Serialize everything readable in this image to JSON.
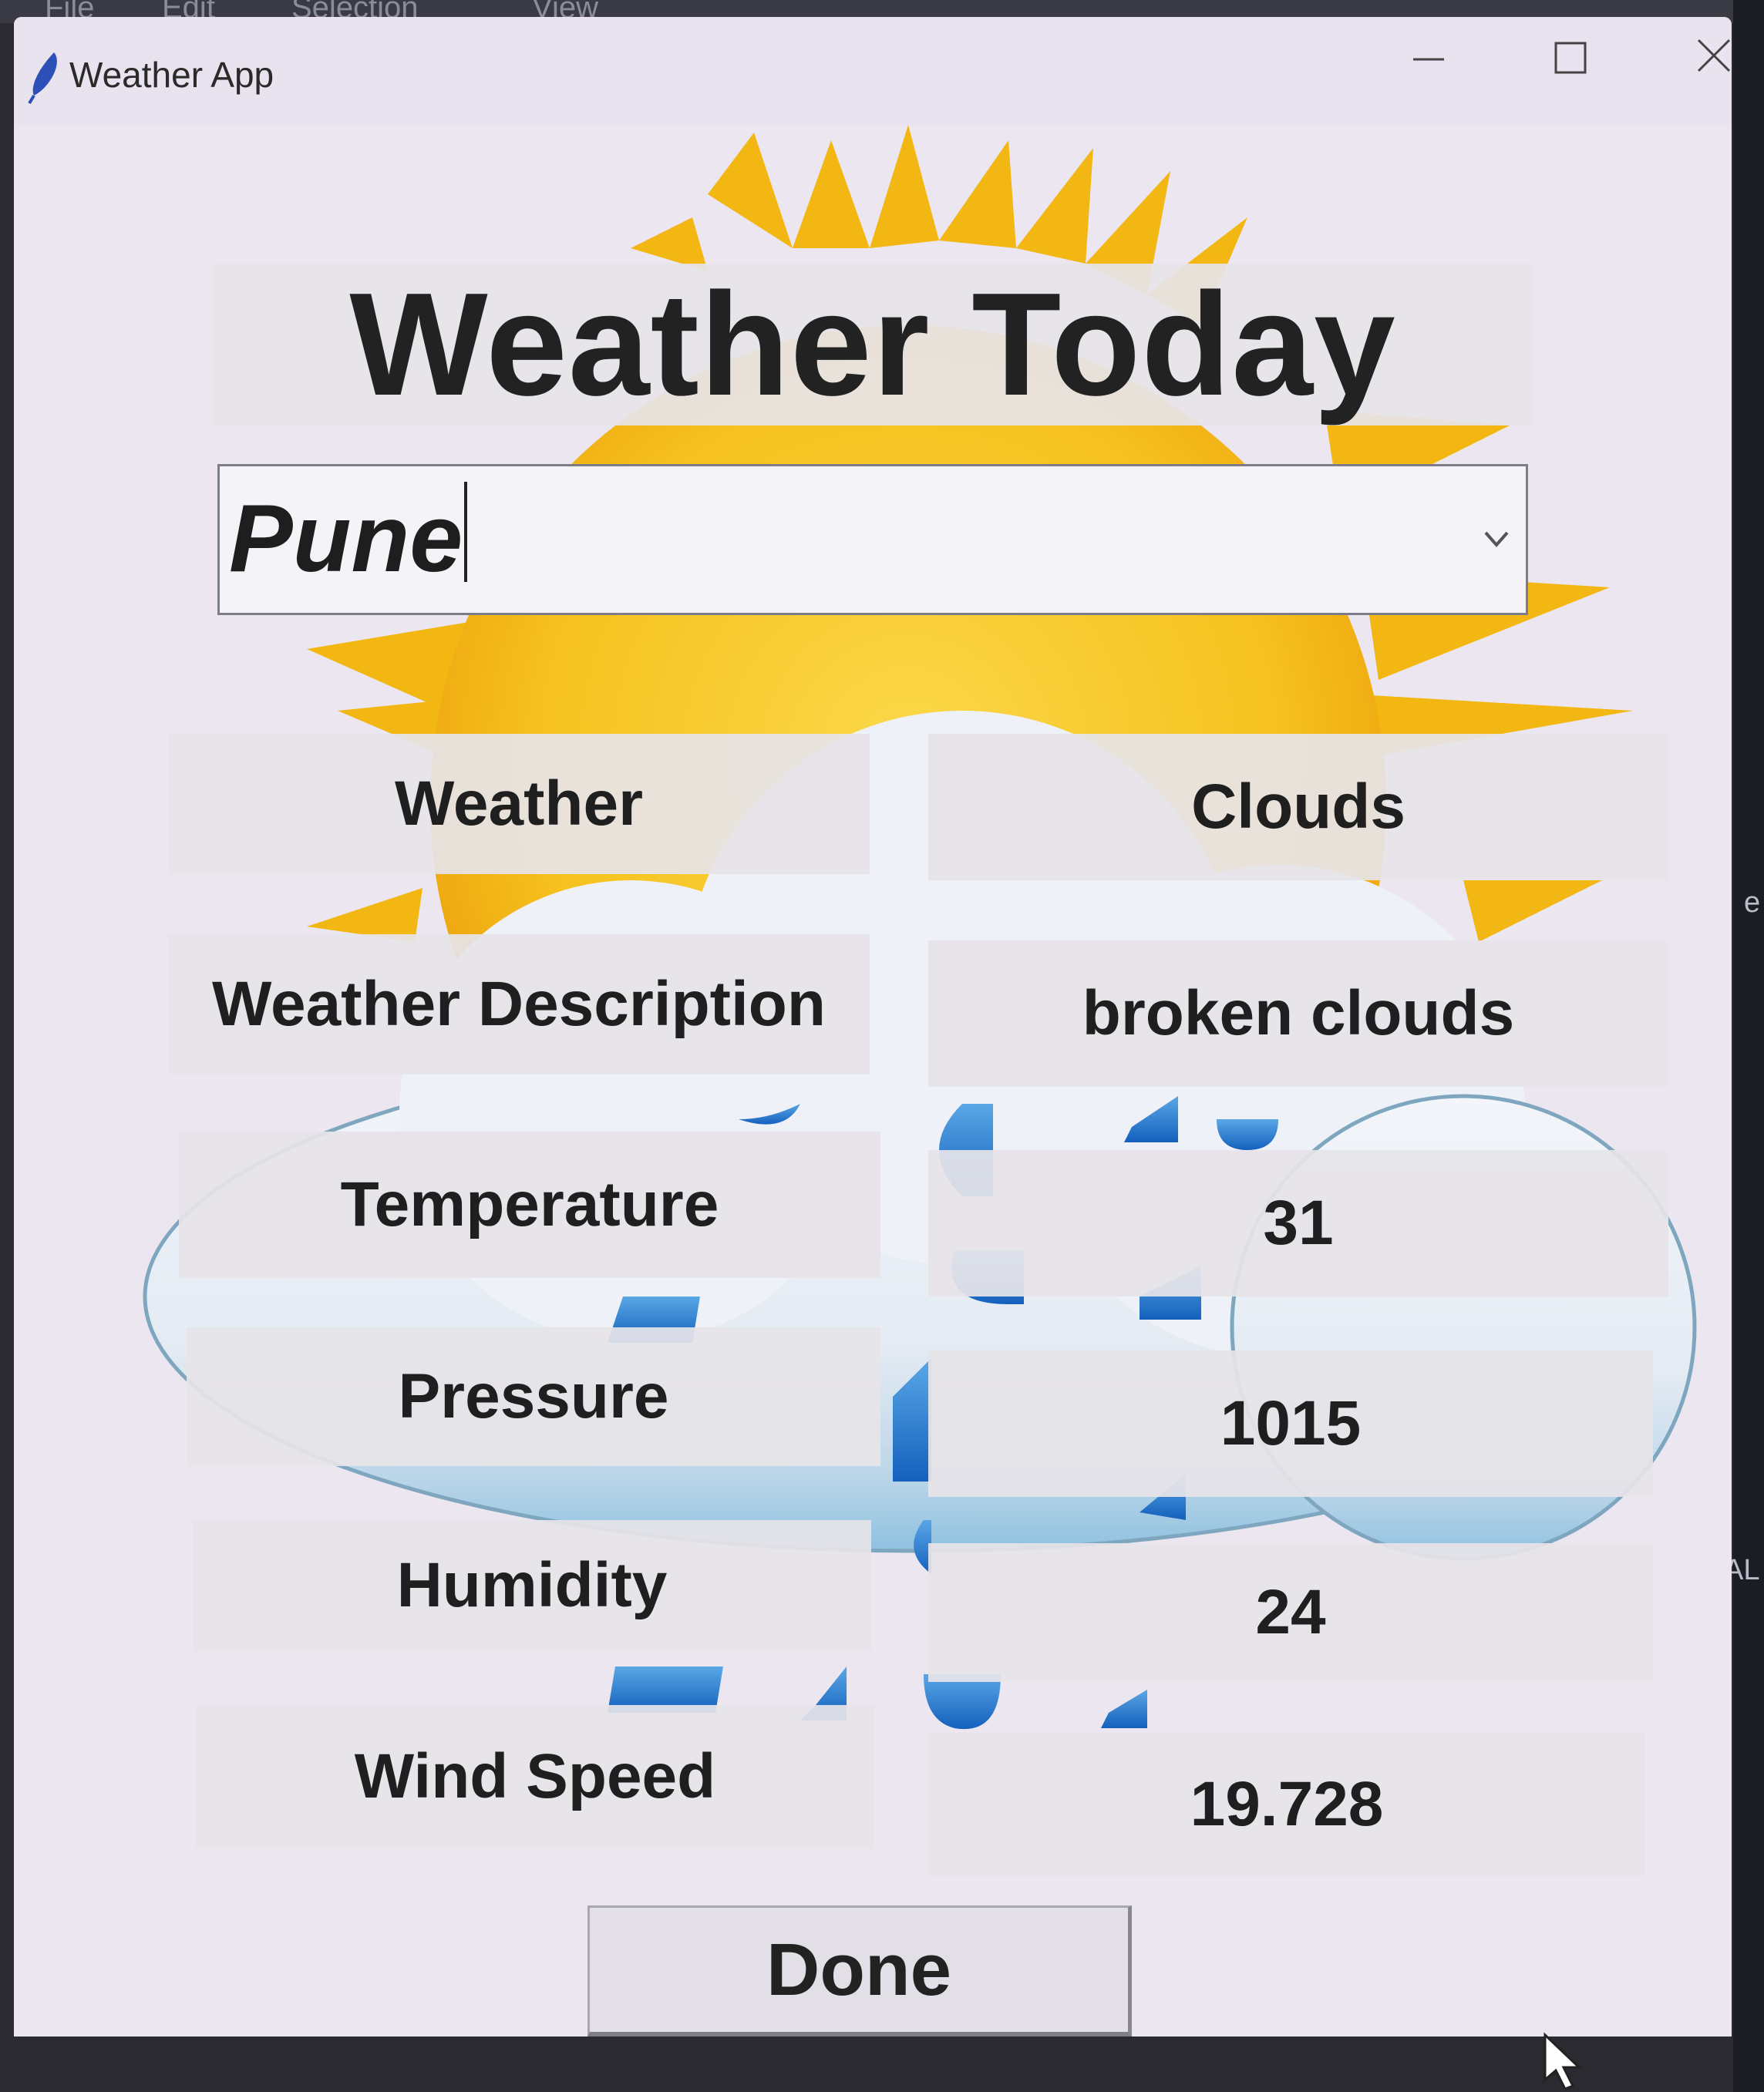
{
  "background": {
    "menu_items": [
      "File",
      "Edit",
      "Selection",
      "View"
    ],
    "side_text": [
      "e",
      "AL"
    ]
  },
  "window": {
    "title": "Weather App",
    "controls": [
      "minimize-icon",
      "maximize-icon",
      "close-icon"
    ]
  },
  "app": {
    "heading": "Weather Today",
    "city_input": {
      "value": "Pune"
    },
    "rows": [
      {
        "label": "Weather",
        "value": "Clouds"
      },
      {
        "label": "Weather Description",
        "value": "broken clouds"
      },
      {
        "label": "Temperature",
        "value": "31"
      },
      {
        "label": "Pressure",
        "value": "1015"
      },
      {
        "label": "Humidity",
        "value": "24"
      },
      {
        "label": "Wind Speed",
        "value": "19.728"
      }
    ],
    "done_label": "Done"
  },
  "colors": {
    "window_bg": "#ebe6f0",
    "sun": "#f6c21e",
    "sun_rays": "#f3b714",
    "cloud": "#e9eef5",
    "rain": "#1c6fc9"
  }
}
